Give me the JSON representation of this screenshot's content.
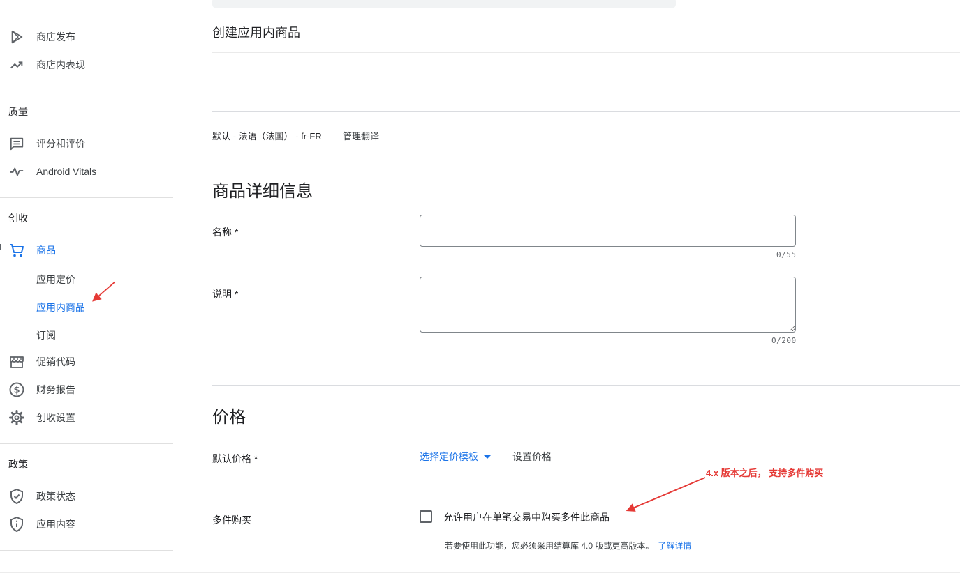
{
  "sidebar": {
    "publish": {
      "label": "商店发布",
      "icon": "play-store-icon"
    },
    "performance": {
      "label": "商店内表现",
      "icon": "trending-up-icon"
    },
    "quality_head": "质量",
    "ratings": {
      "label": "评分和评价",
      "icon": "review-icon"
    },
    "vitals": {
      "label": "Android Vitals",
      "icon": "vitals-pulse-icon"
    },
    "monetize_head": "创收",
    "products": {
      "label": "商品",
      "icon": "cart-icon"
    },
    "sub_items": [
      "应用定价",
      "应用内商品",
      "订阅"
    ],
    "promo": {
      "label": "促销代码",
      "icon": "store-icon"
    },
    "finance": {
      "label": "财务报告",
      "icon": "dollar-icon"
    },
    "monetize_settings": {
      "label": "创收设置",
      "icon": "gear-icon"
    },
    "policy_head": "政策",
    "policy_status": {
      "label": "政策状态",
      "icon": "shield-check-icon"
    },
    "app_content": {
      "label": "应用内容",
      "icon": "info-shield-icon"
    }
  },
  "main": {
    "page_heading": "创建应用内商品",
    "lang_default": "默认 - 法语（法国） - fr-FR",
    "lang_manage": "管理翻译",
    "details_title": "商品详细信息",
    "name_label": "名称 *",
    "name_value": "",
    "name_counter": "0/55",
    "desc_label": "说明 *",
    "desc_value": "",
    "desc_counter": "0/200",
    "price_title": "价格",
    "default_price_label": "默认价格 *",
    "pricing_template": "选择定价模板",
    "set_price": "设置价格",
    "multi_label": "多件购买",
    "multi_checkbox_label": "允许用户在单笔交易中购买多件此商品",
    "multi_checked": false,
    "help_text": "若要使用此功能，您必须采用结算库 4.0 版或更高版本。",
    "learn_more": "了解详情",
    "annotation": "4.x 版本之后， 支持多件购买"
  },
  "colors": {
    "accent": "#1a73e8",
    "annotation": "#e53935",
    "divider": "#dadce0"
  }
}
